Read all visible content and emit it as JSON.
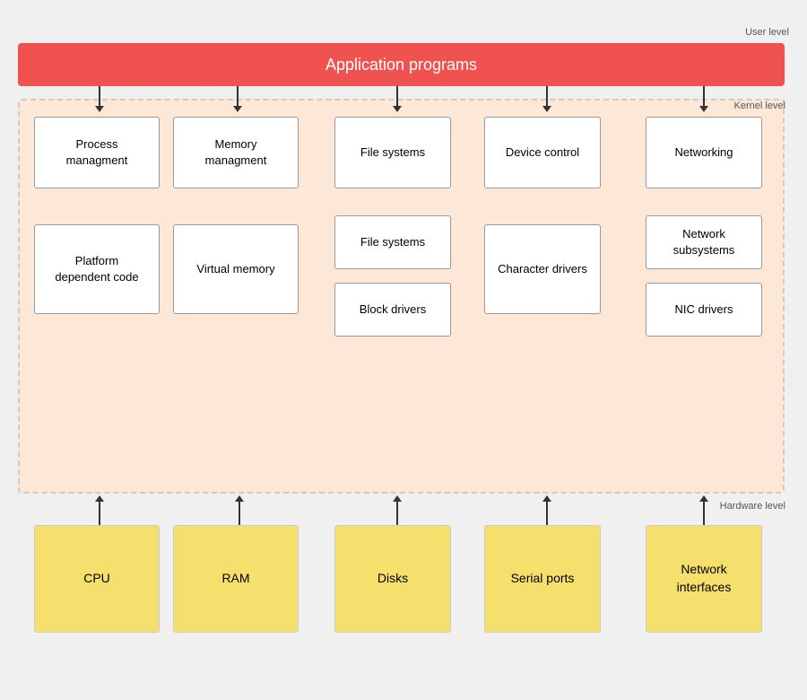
{
  "labels": {
    "user_level": "User level",
    "kernel_level": "Kernel level",
    "hardware_level": "Hardware level",
    "app_programs": "Application programs"
  },
  "kernel_row1": [
    {
      "id": "process-mgmt",
      "text": "Process\nmanagment"
    },
    {
      "id": "memory-mgmt",
      "text": "Memory\nmanagment"
    },
    {
      "id": "file-systems-1",
      "text": "File systems"
    },
    {
      "id": "device-control",
      "text": "Device control"
    },
    {
      "id": "networking",
      "text": "Networking"
    }
  ],
  "kernel_row2": [
    {
      "id": "platform-dep",
      "text": "Platform\ndependent code"
    },
    {
      "id": "virtual-memory",
      "text": "Virtual memory"
    },
    {
      "id": "file-systems-2",
      "text": "File systems"
    },
    {
      "id": "block-drivers",
      "text": "Block drivers"
    },
    {
      "id": "character-drivers",
      "text": "Character drivers"
    },
    {
      "id": "network-subsystems",
      "text": "Network\nsubsystems"
    },
    {
      "id": "nic-drivers",
      "text": "NIC drivers"
    }
  ],
  "hardware": [
    {
      "id": "cpu",
      "text": "CPU"
    },
    {
      "id": "ram",
      "text": "RAM"
    },
    {
      "id": "disks",
      "text": "Disks"
    },
    {
      "id": "serial-ports",
      "text": "Serial ports"
    },
    {
      "id": "network-interfaces",
      "text": "Network\ninterfaces"
    }
  ]
}
